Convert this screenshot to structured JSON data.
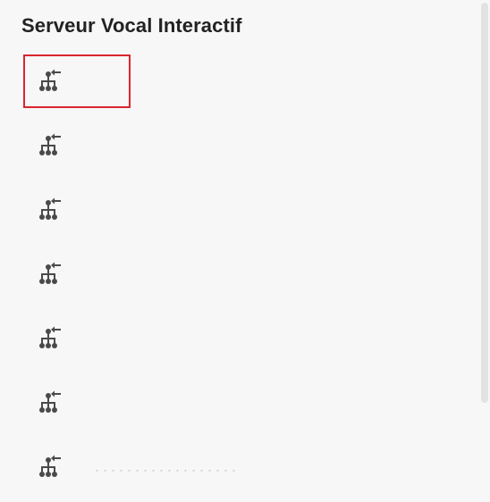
{
  "panel": {
    "title": "Serveur Vocal Interactif"
  },
  "items": [
    {
      "icon": "network-hierarchy-icon",
      "label": "",
      "selected": true
    },
    {
      "icon": "network-hierarchy-icon",
      "label": "",
      "selected": false
    },
    {
      "icon": "network-hierarchy-icon",
      "label": "",
      "selected": false
    },
    {
      "icon": "network-hierarchy-icon",
      "label": "",
      "selected": false
    },
    {
      "icon": "network-hierarchy-icon",
      "label": "",
      "selected": false
    },
    {
      "icon": "network-hierarchy-icon",
      "label": "",
      "selected": false
    },
    {
      "icon": "network-hierarchy-icon",
      "label": "",
      "selected": false
    }
  ],
  "colors": {
    "selection_border": "#d9262e",
    "icon": "#4a4a4a",
    "background": "#f7f7f7",
    "title": "#222222"
  }
}
